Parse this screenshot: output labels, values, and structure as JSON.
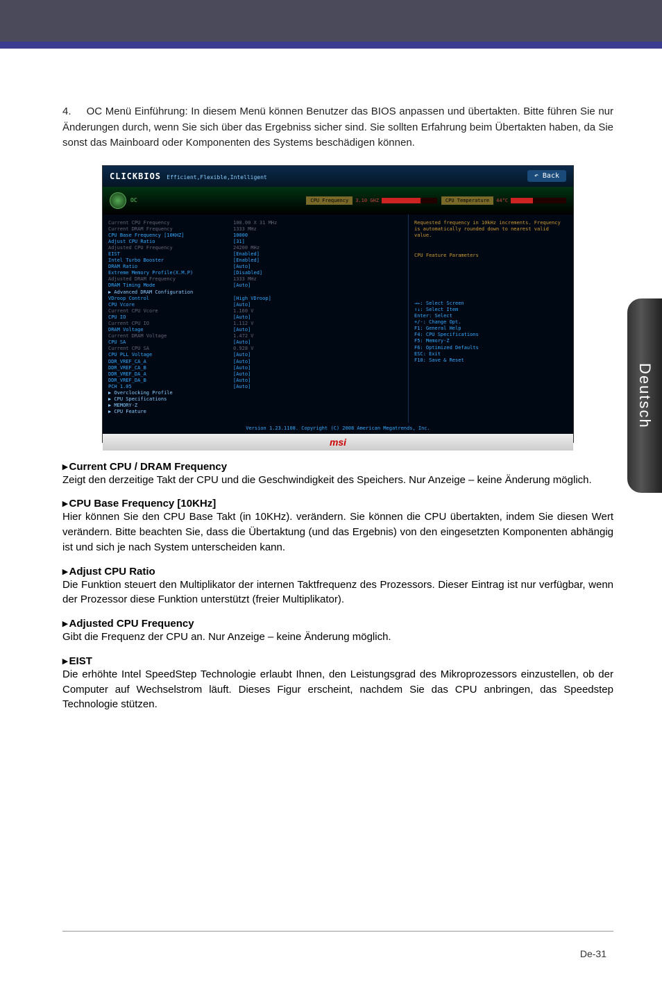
{
  "intro_num": "4.",
  "intro_text": "OC Menü Einführung: In diesem Menü können Benutzer das BIOS anpassen und übertakten. Bitte führen Sie nur Änderungen durch, wenn Sie sich über das Ergebniss sicher sind.  Sie sollten Erfahrung beim Übertakten haben, da Sie sonst das Mainboard oder Komponenten des Systems beschädigen können.",
  "bios": {
    "logo": "CLICKBIOS",
    "logo_sub": "Efficient,Flexible,Intelligent",
    "back": "Back",
    "oc_label": "OC",
    "gauge1_label": "CPU Frequency",
    "gauge1_val": "3.10 GHZ",
    "gauge2_label": "CPU Temperature",
    "gauge2_val": "44°C",
    "rows": [
      {
        "k": "Current CPU Frequency",
        "v": "100.00 X 31 MHz",
        "cls": "gray"
      },
      {
        "k": "Current DRAM Frequency",
        "v": "1333 MHz",
        "cls": "gray"
      },
      {
        "k": "CPU Base Frequency [10KHZ]",
        "v": "10000",
        "cls": ""
      },
      {
        "k": "Adjust CPU Ratio",
        "v": "[31]",
        "cls": ""
      },
      {
        "k": "Adjusted CPU Frequency",
        "v": "24200 MHz",
        "cls": "gray"
      },
      {
        "k": "EIST",
        "v": "[Enabled]",
        "cls": ""
      },
      {
        "k": "Intel Turbo Booster",
        "v": "[Enabled]",
        "cls": ""
      },
      {
        "k": "DRAM Ratio",
        "v": "[Auto]",
        "cls": ""
      },
      {
        "k": "Extreme Memory Profile(X.M.P)",
        "v": "[Disabled]",
        "cls": ""
      },
      {
        "k": "Adjusted DRAM Frequency",
        "v": "1333 MHz",
        "cls": "gray"
      },
      {
        "k": "DRAM Timing Mode",
        "v": "[Auto]",
        "cls": ""
      },
      {
        "k": "▶ Advanced DRAM Configuration",
        "v": "",
        "cls": "sub"
      },
      {
        "k": "VDroop Control",
        "v": "[High VDroop]",
        "cls": ""
      },
      {
        "k": "CPU Vcore",
        "v": "[Auto]",
        "cls": ""
      },
      {
        "k": "Current CPU Vcore",
        "v": "1.160 V",
        "cls": "gray"
      },
      {
        "k": "CPU IO",
        "v": "[Auto]",
        "cls": ""
      },
      {
        "k": "Current CPU IO",
        "v": "1.112 V",
        "cls": "gray"
      },
      {
        "k": "DRAM Voltage",
        "v": "[Auto]",
        "cls": ""
      },
      {
        "k": "Current DRAM Voltage",
        "v": "1.472 V",
        "cls": "gray"
      },
      {
        "k": "CPU SA",
        "v": "[Auto]",
        "cls": ""
      },
      {
        "k": "Current CPU SA",
        "v": "0.928 V",
        "cls": "gray"
      },
      {
        "k": "CPU PLL Voltage",
        "v": "[Auto]",
        "cls": ""
      },
      {
        "k": "DDR_VREF_CA_A",
        "v": "[Auto]",
        "cls": ""
      },
      {
        "k": "DDR_VREF_CA_B",
        "v": "[Auto]",
        "cls": ""
      },
      {
        "k": "DDR_VREF_DA_A",
        "v": "[Auto]",
        "cls": ""
      },
      {
        "k": "DDR_VREF_DA_B",
        "v": "[Auto]",
        "cls": ""
      },
      {
        "k": "PCH 1.05",
        "v": "[Auto]",
        "cls": ""
      },
      {
        "k": "▶ Overclocking Profile",
        "v": "",
        "cls": "sub"
      },
      {
        "k": "▶ CPU Specifications",
        "v": "",
        "cls": "sub"
      },
      {
        "k": "▶ MEMORY-Z",
        "v": "",
        "cls": "sub"
      },
      {
        "k": "▶ CPU Feature",
        "v": "",
        "cls": "sub"
      }
    ],
    "help1": "Requested frequency in 10kHz increments. Frequency is automatically rounded down to nearest valid value.",
    "help2": "CPU Feature Parameters",
    "keys": [
      "→←: Select Screen",
      "↑↓: Select Item",
      "Enter: Select",
      "+/-: Change Opt.",
      "F1: General Help",
      "F4: CPU Specifications",
      "F5: Memory-Z",
      "F6: Optimized Defaults",
      "ESC: Exit",
      "F10: Save & Reset"
    ],
    "footer": "Version 1.23.1108. Copyright (C) 2008 American Megatrends, Inc.",
    "msi": "msi"
  },
  "sections": [
    {
      "title": "Current CPU / DRAM Frequency",
      "body": "Zeigt den derzeitige Takt der CPU und die Geschwindigkeit des Speichers. Nur Anzeige – keine Änderung möglich."
    },
    {
      "title": "CPU Base Frequency [10KHz]",
      "body": "Hier können Sie den CPU Base Takt (in 10KHz). verändern. Sie können die CPU übertakten, indem Sie diesen Wert verändern. Bitte beachten Sie, dass die Übertaktung (und das Ergebnis) von den eingesetzten Komponenten abhängig ist und sich je nach System unterscheiden kann."
    },
    {
      "title": "Adjust CPU Ratio",
      "body": "Die Funktion steuert den Multiplikator der internen Taktfrequenz des Prozessors. Dieser Eintrag ist nur verfügbar, wenn der Prozessor diese Funktion unterstützt (freier Multiplikator)."
    },
    {
      "title": "Adjusted CPU Frequency",
      "body": "Gibt die Frequenz der CPU an. Nur Anzeige – keine Änderung möglich."
    },
    {
      "title": "EIST",
      "body": "Die erhöhte Intel SpeedStep Technologie erlaubt Ihnen, den Leistungsgrad des Mikroprozessors einzustellen, ob der Computer auf Wechselstrom läuft. Dieses Figur erscheint, nachdem Sie das CPU anbringen, das Speedstep Technologie stützen."
    }
  ],
  "side_tab": "Deutsch",
  "page_num": "De-31"
}
